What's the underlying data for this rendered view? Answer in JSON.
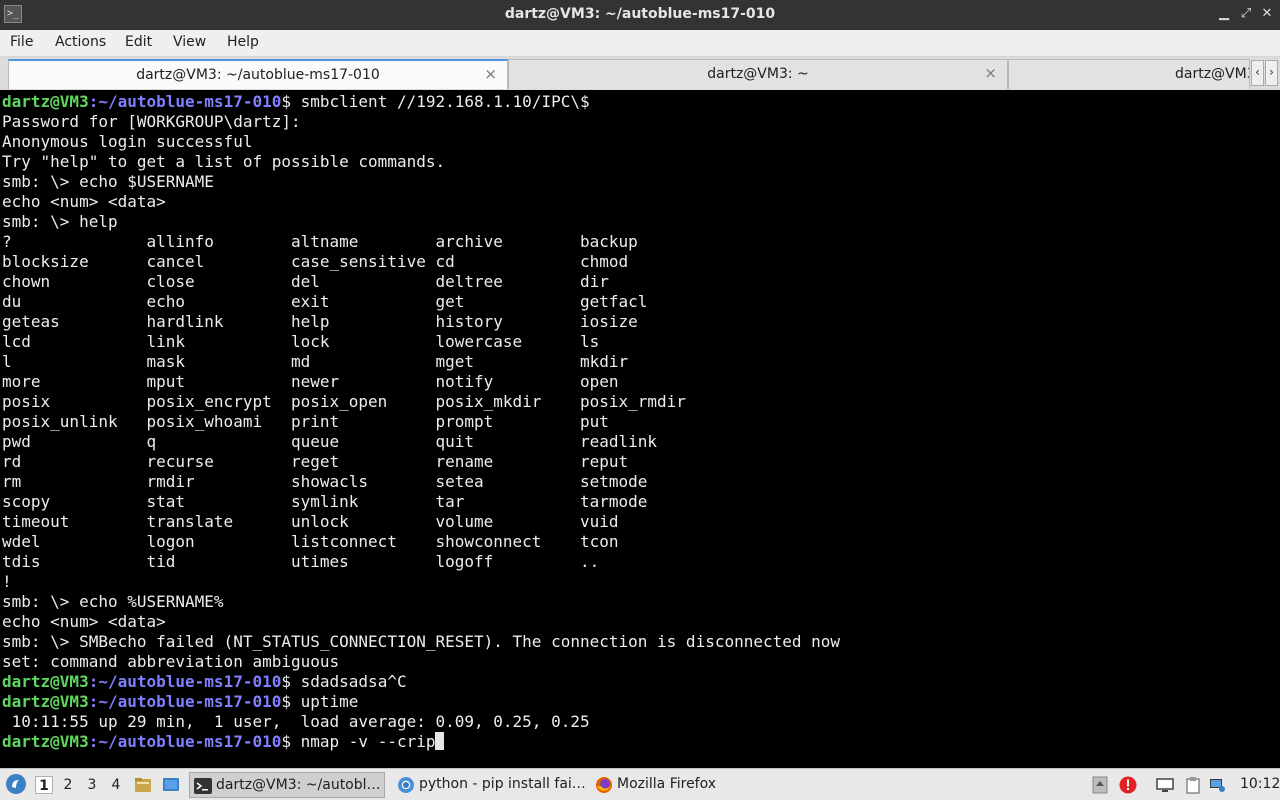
{
  "window": {
    "title": "dartz@VM3: ~/autoblue-ms17-010",
    "app_icon_glyph": ">_",
    "min_glyph": "▁",
    "max_glyph": "⤢",
    "close_glyph": "✕"
  },
  "menu": [
    "File",
    "Actions",
    "Edit",
    "View",
    "Help"
  ],
  "tabs": [
    {
      "label": "dartz@VM3: ~/autoblue-ms17-010",
      "active": true
    },
    {
      "label": "dartz@VM3: ~",
      "active": false
    },
    {
      "label": "dartz@VM3",
      "active": false
    }
  ],
  "tab_close_glyph": "×",
  "tab_nav": {
    "left": "‹",
    "right": "›"
  },
  "terminal": {
    "prompt_user": "dartz@VM3",
    "prompt_path": ":~/autoblue-ms17-010",
    "lines": [
      {
        "kind": "prompt",
        "cmd": "$ smbclient //192.168.1.10/IPC\\$"
      },
      {
        "kind": "text",
        "text": "Password for [WORKGROUP\\dartz]:"
      },
      {
        "kind": "text",
        "text": "Anonymous login successful"
      },
      {
        "kind": "text",
        "text": "Try \"help\" to get a list of possible commands."
      },
      {
        "kind": "text",
        "text": "smb: \\> echo $USERNAME"
      },
      {
        "kind": "text",
        "text": "echo <num> <data>"
      },
      {
        "kind": "text",
        "text": "smb: \\> help"
      },
      {
        "kind": "text",
        "text": "?              allinfo        altname        archive        backup"
      },
      {
        "kind": "text",
        "text": "blocksize      cancel         case_sensitive cd             chmod"
      },
      {
        "kind": "text",
        "text": "chown          close          del            deltree        dir"
      },
      {
        "kind": "text",
        "text": "du             echo           exit           get            getfacl"
      },
      {
        "kind": "text",
        "text": "geteas         hardlink       help           history        iosize"
      },
      {
        "kind": "text",
        "text": "lcd            link           lock           lowercase      ls"
      },
      {
        "kind": "text",
        "text": "l              mask           md             mget           mkdir"
      },
      {
        "kind": "text",
        "text": "more           mput           newer          notify         open"
      },
      {
        "kind": "text",
        "text": "posix          posix_encrypt  posix_open     posix_mkdir    posix_rmdir"
      },
      {
        "kind": "text",
        "text": "posix_unlink   posix_whoami   print          prompt         put"
      },
      {
        "kind": "text",
        "text": "pwd            q              queue          quit           readlink"
      },
      {
        "kind": "text",
        "text": "rd             recurse        reget          rename         reput"
      },
      {
        "kind": "text",
        "text": "rm             rmdir          showacls       setea          setmode"
      },
      {
        "kind": "text",
        "text": "scopy          stat           symlink        tar            tarmode"
      },
      {
        "kind": "text",
        "text": "timeout        translate      unlock         volume         vuid"
      },
      {
        "kind": "text",
        "text": "wdel           logon          listconnect    showconnect    tcon"
      },
      {
        "kind": "text",
        "text": "tdis           tid            utimes         logoff         .."
      },
      {
        "kind": "text",
        "text": "!"
      },
      {
        "kind": "text",
        "text": "smb: \\> echo %USERNAME%"
      },
      {
        "kind": "text",
        "text": "echo <num> <data>"
      },
      {
        "kind": "text",
        "text": "smb: \\> SMBecho failed (NT_STATUS_CONNECTION_RESET). The connection is disconnected now"
      },
      {
        "kind": "text",
        "text": "set: command abbreviation ambiguous"
      },
      {
        "kind": "prompt",
        "cmd": "$ sdadsadsa^C"
      },
      {
        "kind": "prompt",
        "cmd": "$ uptime"
      },
      {
        "kind": "text",
        "text": " 10:11:55 up 29 min,  1 user,  load average: 0.09, 0.25, 0.25"
      },
      {
        "kind": "prompt",
        "cmd": "$ nmap -v --crip",
        "cursor": true
      }
    ]
  },
  "taskbar": {
    "workspaces": [
      {
        "label": "1",
        "active": true
      },
      {
        "label": "2",
        "active": false
      },
      {
        "label": "3",
        "active": false
      },
      {
        "label": "4",
        "active": false
      }
    ],
    "buttons": [
      {
        "label": "dartz@VM3: ~/autobl…",
        "active": true,
        "icon": "terminal-icon"
      },
      {
        "label": "python - pip install fai…",
        "active": false,
        "icon": "chromium-icon"
      },
      {
        "label": "Mozilla Firefox",
        "active": false,
        "icon": "firefox-icon"
      }
    ],
    "clock": "10:12",
    "colors": {
      "accent": "#5294e2",
      "prompt_user": "#5fd75f",
      "prompt_path": "#7f7fff",
      "alert": "#e02424"
    }
  }
}
